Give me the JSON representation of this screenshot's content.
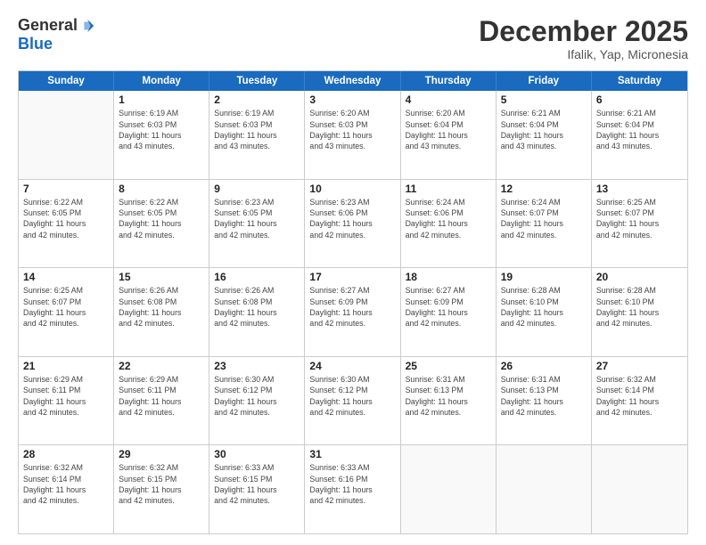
{
  "logo": {
    "general": "General",
    "blue": "Blue"
  },
  "header": {
    "month": "December 2025",
    "location": "Ifalik, Yap, Micronesia"
  },
  "weekdays": [
    "Sunday",
    "Monday",
    "Tuesday",
    "Wednesday",
    "Thursday",
    "Friday",
    "Saturday"
  ],
  "rows": [
    [
      {
        "day": "",
        "info": ""
      },
      {
        "day": "1",
        "info": "Sunrise: 6:19 AM\nSunset: 6:03 PM\nDaylight: 11 hours\nand 43 minutes."
      },
      {
        "day": "2",
        "info": "Sunrise: 6:19 AM\nSunset: 6:03 PM\nDaylight: 11 hours\nand 43 minutes."
      },
      {
        "day": "3",
        "info": "Sunrise: 6:20 AM\nSunset: 6:03 PM\nDaylight: 11 hours\nand 43 minutes."
      },
      {
        "day": "4",
        "info": "Sunrise: 6:20 AM\nSunset: 6:04 PM\nDaylight: 11 hours\nand 43 minutes."
      },
      {
        "day": "5",
        "info": "Sunrise: 6:21 AM\nSunset: 6:04 PM\nDaylight: 11 hours\nand 43 minutes."
      },
      {
        "day": "6",
        "info": "Sunrise: 6:21 AM\nSunset: 6:04 PM\nDaylight: 11 hours\nand 43 minutes."
      }
    ],
    [
      {
        "day": "7",
        "info": ""
      },
      {
        "day": "8",
        "info": "Sunrise: 6:22 AM\nSunset: 6:05 PM\nDaylight: 11 hours\nand 42 minutes."
      },
      {
        "day": "9",
        "info": "Sunrise: 6:23 AM\nSunset: 6:05 PM\nDaylight: 11 hours\nand 42 minutes."
      },
      {
        "day": "10",
        "info": "Sunrise: 6:23 AM\nSunset: 6:06 PM\nDaylight: 11 hours\nand 42 minutes."
      },
      {
        "day": "11",
        "info": "Sunrise: 6:24 AM\nSunset: 6:06 PM\nDaylight: 11 hours\nand 42 minutes."
      },
      {
        "day": "12",
        "info": "Sunrise: 6:24 AM\nSunset: 6:07 PM\nDaylight: 11 hours\nand 42 minutes."
      },
      {
        "day": "13",
        "info": "Sunrise: 6:25 AM\nSunset: 6:07 PM\nDaylight: 11 hours\nand 42 minutes."
      }
    ],
    [
      {
        "day": "14",
        "info": ""
      },
      {
        "day": "15",
        "info": "Sunrise: 6:26 AM\nSunset: 6:08 PM\nDaylight: 11 hours\nand 42 minutes."
      },
      {
        "day": "16",
        "info": "Sunrise: 6:26 AM\nSunset: 6:08 PM\nDaylight: 11 hours\nand 42 minutes."
      },
      {
        "day": "17",
        "info": "Sunrise: 6:27 AM\nSunset: 6:09 PM\nDaylight: 11 hours\nand 42 minutes."
      },
      {
        "day": "18",
        "info": "Sunrise: 6:27 AM\nSunset: 6:09 PM\nDaylight: 11 hours\nand 42 minutes."
      },
      {
        "day": "19",
        "info": "Sunrise: 6:28 AM\nSunset: 6:10 PM\nDaylight: 11 hours\nand 42 minutes."
      },
      {
        "day": "20",
        "info": "Sunrise: 6:28 AM\nSunset: 6:10 PM\nDaylight: 11 hours\nand 42 minutes."
      }
    ],
    [
      {
        "day": "21",
        "info": ""
      },
      {
        "day": "22",
        "info": "Sunrise: 6:29 AM\nSunset: 6:11 PM\nDaylight: 11 hours\nand 42 minutes."
      },
      {
        "day": "23",
        "info": "Sunrise: 6:30 AM\nSunset: 6:12 PM\nDaylight: 11 hours\nand 42 minutes."
      },
      {
        "day": "24",
        "info": "Sunrise: 6:30 AM\nSunset: 6:12 PM\nDaylight: 11 hours\nand 42 minutes."
      },
      {
        "day": "25",
        "info": "Sunrise: 6:31 AM\nSunset: 6:13 PM\nDaylight: 11 hours\nand 42 minutes."
      },
      {
        "day": "26",
        "info": "Sunrise: 6:31 AM\nSunset: 6:13 PM\nDaylight: 11 hours\nand 42 minutes."
      },
      {
        "day": "27",
        "info": "Sunrise: 6:32 AM\nSunset: 6:14 PM\nDaylight: 11 hours\nand 42 minutes."
      }
    ],
    [
      {
        "day": "28",
        "info": "Sunrise: 6:32 AM\nSunset: 6:14 PM\nDaylight: 11 hours\nand 42 minutes."
      },
      {
        "day": "29",
        "info": "Sunrise: 6:32 AM\nSunset: 6:15 PM\nDaylight: 11 hours\nand 42 minutes."
      },
      {
        "day": "30",
        "info": "Sunrise: 6:33 AM\nSunset: 6:15 PM\nDaylight: 11 hours\nand 42 minutes."
      },
      {
        "day": "31",
        "info": "Sunrise: 6:33 AM\nSunset: 6:16 PM\nDaylight: 11 hours\nand 42 minutes."
      },
      {
        "day": "",
        "info": ""
      },
      {
        "day": "",
        "info": ""
      },
      {
        "day": "",
        "info": ""
      }
    ]
  ],
  "row0_day7_info": "Sunrise: 6:22 AM\nSunset: 6:05 PM\nDaylight: 11 hours\nand 42 minutes.",
  "row2_day14_info": "Sunrise: 6:25 AM\nSunset: 6:07 PM\nDaylight: 11 hours\nand 42 minutes.",
  "row3_day21_info": "Sunrise: 6:29 AM\nSunset: 6:11 PM\nDaylight: 11 hours\nand 42 minutes."
}
